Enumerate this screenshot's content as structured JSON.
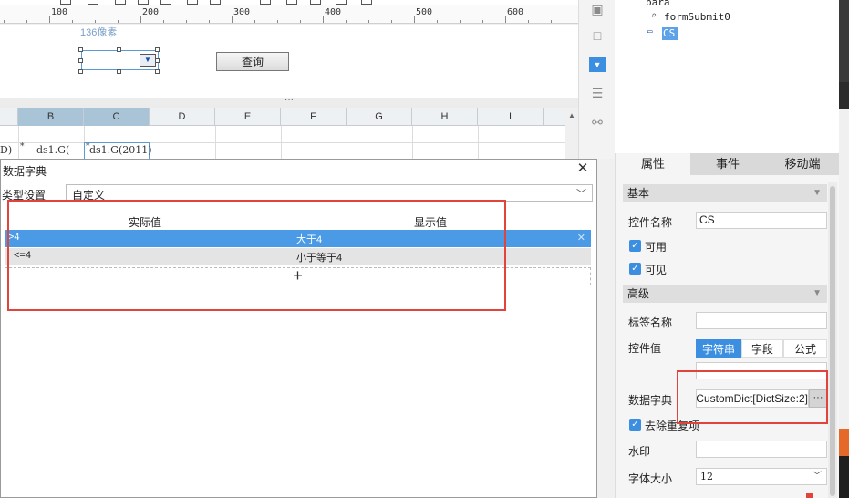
{
  "ruler": {
    "ticks": [
      "100",
      "200",
      "300",
      "400",
      "500",
      "600"
    ]
  },
  "form": {
    "size_label": "136像素",
    "query_button": "查询",
    "splitter_dots": "···"
  },
  "sheet": {
    "columns": [
      "B",
      "C",
      "D",
      "E",
      "F",
      "G",
      "H",
      "I"
    ],
    "row_prefix": "D)",
    "cell_b": "ds1.G(",
    "cell_c": "ds1.G(2011)",
    "marks": [
      "*",
      "*"
    ]
  },
  "tree": {
    "nodes": [
      "para",
      "formSubmit0",
      "CS"
    ]
  },
  "dialog": {
    "title": "数据字典",
    "close": "✕",
    "type_label": "类型设置",
    "type_value": "自定义",
    "columns": [
      "实际值",
      "显示值"
    ],
    "rows": [
      {
        "actual": ">4",
        "display": "大于4"
      },
      {
        "actual": "<=4",
        "display": "小于等于4"
      }
    ],
    "add": "+"
  },
  "panel": {
    "tabs": [
      "属性",
      "事件",
      "移动端"
    ],
    "basic": "基本",
    "control_name_label": "控件名称",
    "control_name": "CS",
    "enabled": "可用",
    "visible": "可见",
    "advanced": "高级",
    "tag_name_label": "标签名称",
    "tag_name": "",
    "value_label": "控件值",
    "value_modes": [
      "字符串",
      "字段",
      "公式"
    ],
    "dict_label": "数据字典",
    "dict_value": "CustomDict[DictSize:2]",
    "dict_more": "···",
    "remove_dup": "去除重复项",
    "watermark_label": "水印",
    "font_size_label": "字体大小",
    "font_size": "12"
  },
  "colors": {
    "accent": "#3b8ee0",
    "highlight_red": "#e0443c",
    "row_selected": "#4a9ae6"
  }
}
